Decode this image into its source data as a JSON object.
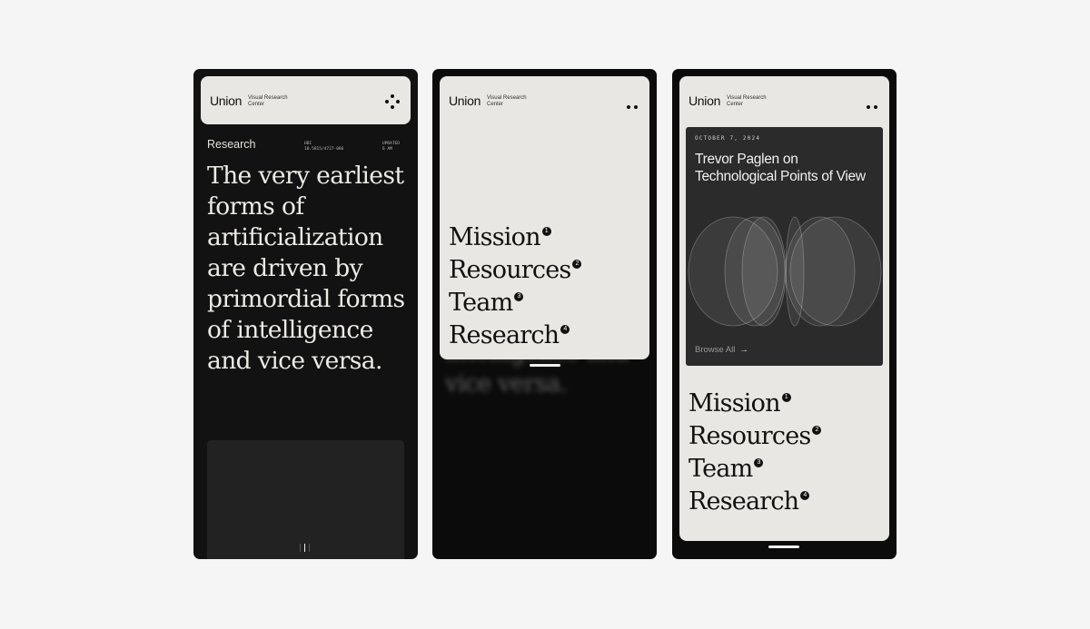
{
  "brand": {
    "name": "Union",
    "tagline_line1": "Visual Research",
    "tagline_line2": "Center"
  },
  "screen1": {
    "section_label": "Research",
    "meta_left_line1": "HDI",
    "meta_left_line2": "10.5815/4727-086",
    "meta_right_line1": "UPDATED",
    "meta_right_line2": "6 AM",
    "headline": "The very earliest forms of artificialization are driven by primordial forms of intelligence and vice versa."
  },
  "menu": [
    {
      "label": "Mission",
      "number": "1"
    },
    {
      "label": "Resources",
      "number": "2"
    },
    {
      "label": "Team",
      "number": "3"
    },
    {
      "label": "Research",
      "number": "4"
    }
  ],
  "screen2": {
    "blurred_line1": "intelligence and",
    "blurred_line2": "vice versa."
  },
  "screen3": {
    "feature_date": "OCTOBER 7, 2024",
    "feature_title": "Trevor Paglen on Technological Points of View",
    "browse_label": "Browse All",
    "browse_arrow": "→"
  },
  "icons": {
    "menu_toggle_open": "four-dots-icon",
    "menu_toggle": "two-dots-icon",
    "arrow": "arrow-right-icon"
  },
  "colors": {
    "background": "#f5f5f5",
    "phone": "#121212",
    "panel": "#e9e7e3",
    "feature_card": "#2b2b2b",
    "text_dark": "#111111",
    "text_light": "#ecebe6"
  }
}
